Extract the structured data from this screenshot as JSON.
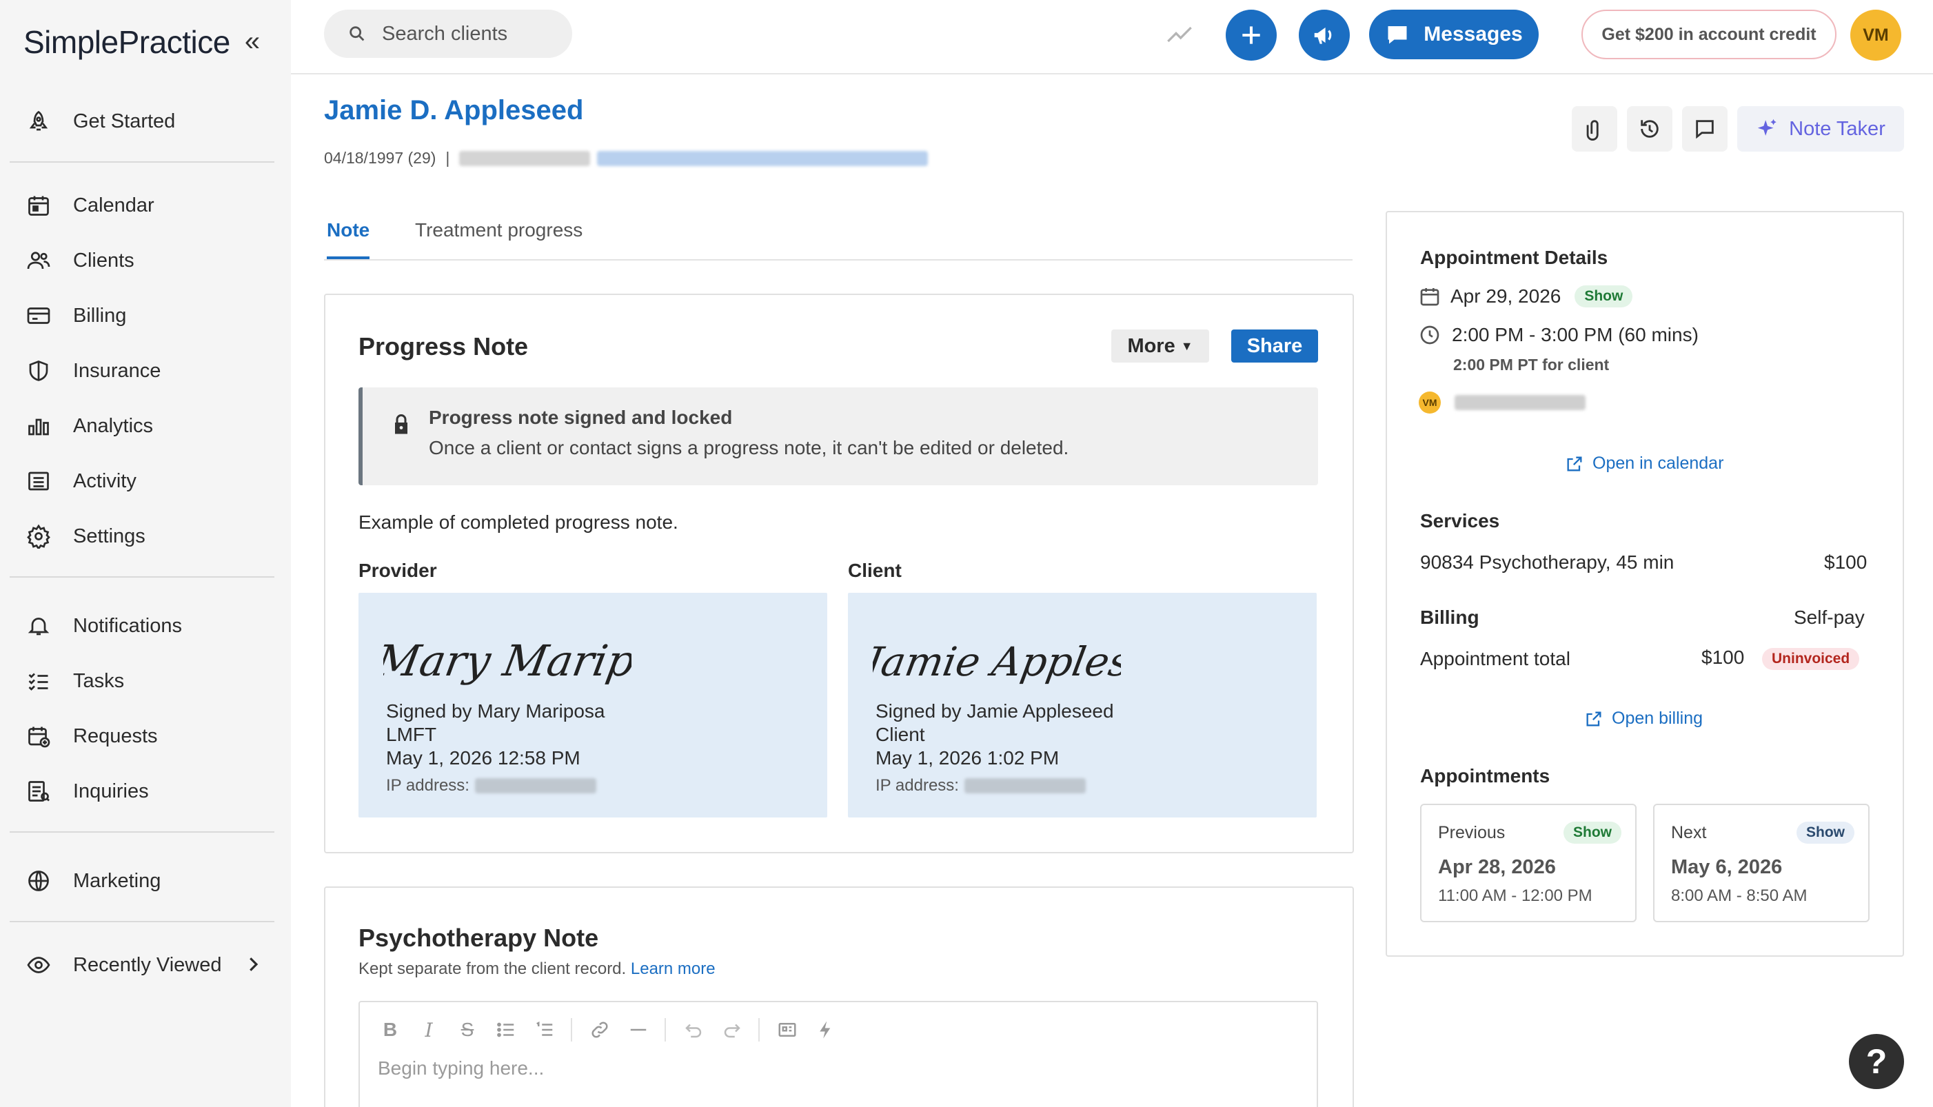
{
  "brand": {
    "logo": "SimplePractice"
  },
  "sidebar": {
    "items": [
      {
        "label": "Get Started",
        "icon": "rocket-icon"
      },
      {
        "label": "Calendar",
        "icon": "calendar-icon"
      },
      {
        "label": "Clients",
        "icon": "users-icon"
      },
      {
        "label": "Billing",
        "icon": "credit-card-icon"
      },
      {
        "label": "Insurance",
        "icon": "shield-icon"
      },
      {
        "label": "Analytics",
        "icon": "bar-chart-icon"
      },
      {
        "label": "Activity",
        "icon": "list-icon"
      },
      {
        "label": "Settings",
        "icon": "gear-icon"
      },
      {
        "label": "Notifications",
        "icon": "bell-icon"
      },
      {
        "label": "Tasks",
        "icon": "checklist-icon"
      },
      {
        "label": "Requests",
        "icon": "calendar-plus-icon"
      },
      {
        "label": "Inquiries",
        "icon": "inquiry-icon"
      },
      {
        "label": "Marketing",
        "icon": "globe-icon"
      },
      {
        "label": "Recently Viewed",
        "icon": "eye-icon"
      }
    ]
  },
  "header": {
    "search_placeholder": "Search clients",
    "messages_label": "Messages",
    "credit_label": "Get $200 in account credit",
    "avatar_initials": "VM",
    "accent_color": "#1b6ec2"
  },
  "client": {
    "name": "Jamie D. Appleseed",
    "dob": "04/18/1997 (29)",
    "separator": "|"
  },
  "toolbar": {
    "note_taker_label": "Note Taker"
  },
  "tabs": [
    {
      "label": "Note",
      "active": true
    },
    {
      "label": "Treatment progress",
      "active": false
    }
  ],
  "progress_note": {
    "title": "Progress Note",
    "more_label": "More",
    "share_label": "Share",
    "lock_title": "Progress note signed and locked",
    "lock_desc": "Once a client or contact signs a progress note, it can't be edited or deleted.",
    "body": "Example of completed progress note.",
    "provider": {
      "heading": "Provider",
      "signature": "Mary Mariposa",
      "signed_by": "Signed by Mary Mariposa",
      "role": "LMFT",
      "date": "May 1, 2026 12:58 PM",
      "ip_label": "IP address:"
    },
    "client": {
      "heading": "Client",
      "signature": "Jamie Appleseed",
      "signed_by": "Signed by Jamie Appleseed",
      "role": "Client",
      "date": "May 1, 2026 1:02 PM",
      "ip_label": "IP address:"
    }
  },
  "psychotherapy_note": {
    "title": "Psychotherapy Note",
    "subtitle": "Kept separate from the client record.",
    "learn_more": "Learn more",
    "placeholder": "Begin typing here..."
  },
  "appointment": {
    "heading": "Appointment Details",
    "date": "Apr 29, 2026",
    "status": "Show",
    "time": "2:00 PM - 3:00 PM (60 mins)",
    "client_time": "2:00 PM PT for client",
    "clinician_initials": "VM",
    "open_calendar": "Open in calendar",
    "services_heading": "Services",
    "service_name": "90834 Psychotherapy, 45 min",
    "service_price": "$100",
    "billing_heading": "Billing",
    "billing_type": "Self-pay",
    "total_label": "Appointment total",
    "total_value": "$100",
    "invoice_status": "Uninvoiced",
    "open_billing": "Open billing",
    "appointments_heading": "Appointments",
    "previous": {
      "label": "Previous",
      "status": "Show",
      "date": "Apr 28, 2026",
      "time": "11:00 AM - 12:00 PM"
    },
    "next": {
      "label": "Next",
      "status": "Show",
      "date": "May 6, 2026",
      "time": "8:00 AM - 8:50 AM"
    }
  },
  "help": {
    "label": "?"
  }
}
